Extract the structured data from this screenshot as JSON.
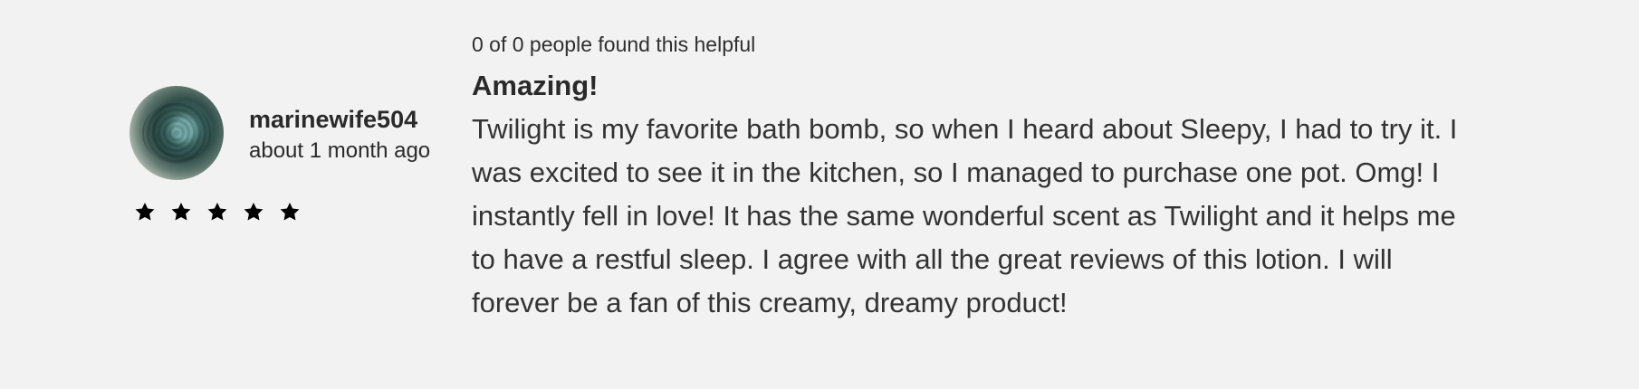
{
  "review": {
    "helpful_text": "0 of 0 people found this helpful",
    "author": {
      "name": "marinewife504",
      "date": "about 1 month ago"
    },
    "rating": {
      "value": 5,
      "max": 5
    },
    "title": "Amazing!",
    "body": "Twilight is my favorite bath bomb, so when I heard about Sleepy, I had to try it. I was excited to see it in the kitchen, so I managed to purchase one pot. Omg! I instantly fell in love! It has the same wonderful scent as Twilight and it helps me to have a restful sleep. I agree with all the great reviews of this lotion. I will forever be a fan of this creamy, dreamy product!"
  },
  "colors": {
    "background": "#f2f2f2",
    "text": "#333333",
    "star": "#000000"
  },
  "icons": {
    "star": "star-icon"
  }
}
